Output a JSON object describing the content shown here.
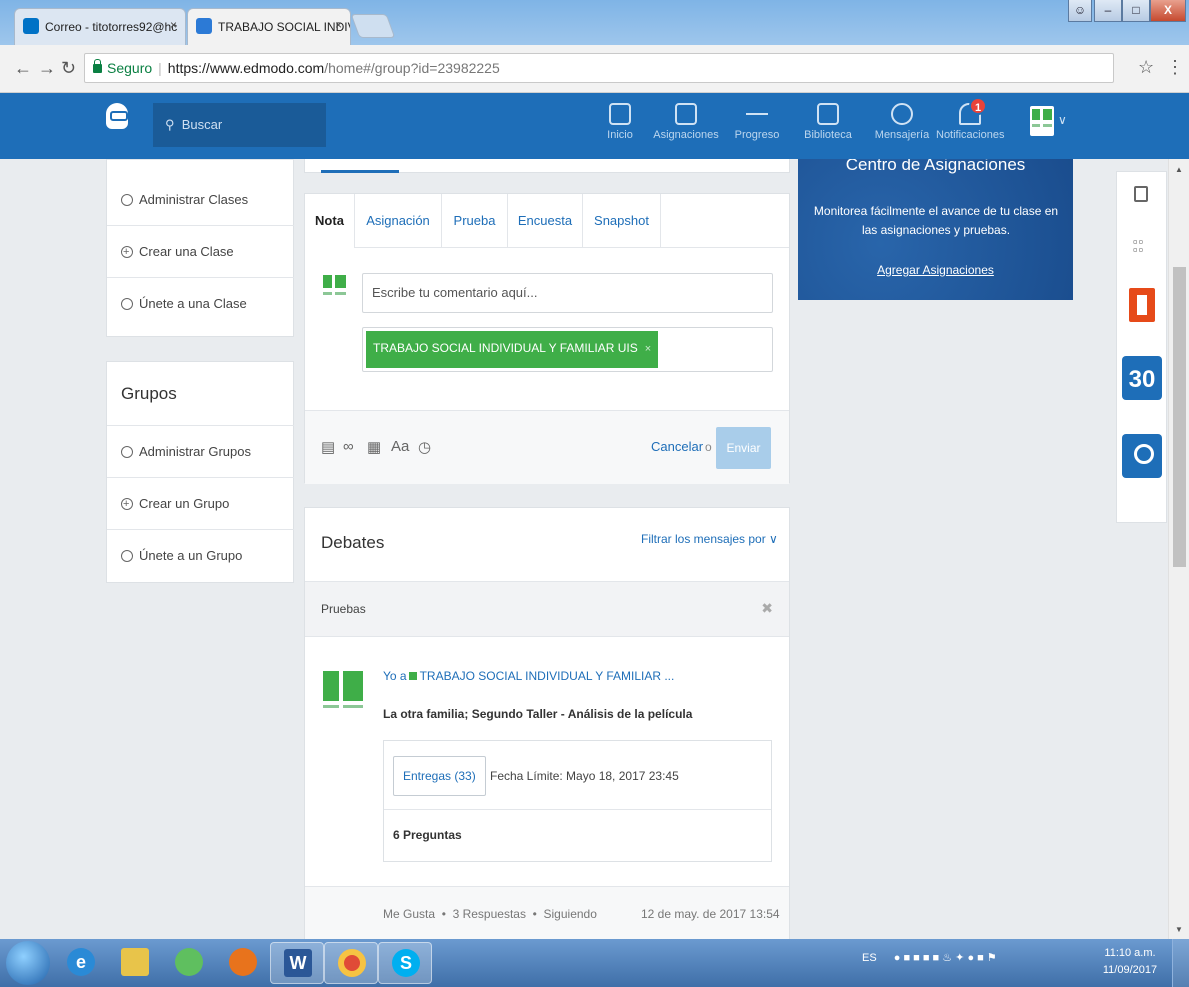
{
  "browser": {
    "tabs": [
      {
        "title": "Correo - titotorres92@hc",
        "close": "×",
        "favicon_color": "#0072c6"
      },
      {
        "title": "TRABAJO SOCIAL INDIVI",
        "close": "×",
        "favicon_color": "#2c7ad6"
      }
    ],
    "secure_label": "Seguro",
    "url_main": "https://www.edmodo.com",
    "url_rest": "/home#/group?id=23982225"
  },
  "header": {
    "search_placeholder": "Buscar",
    "nav": [
      {
        "label": "Inicio"
      },
      {
        "label": "Asignaciones"
      },
      {
        "label": "Progreso"
      },
      {
        "label": "Biblioteca"
      },
      {
        "label": "Mensajería"
      },
      {
        "label": "Notificaciones"
      }
    ],
    "notification_count": "1",
    "accent": "#1e6eb8"
  },
  "sidebar": {
    "classes": [
      {
        "label": "Administrar Clases"
      },
      {
        "label": "Crear una Clase"
      },
      {
        "label": "Únete a una Clase"
      }
    ],
    "groups_title": "Grupos",
    "groups": [
      {
        "label": "Administrar Grupos"
      },
      {
        "label": "Crear un Grupo"
      },
      {
        "label": "Únete a un Grupo"
      }
    ]
  },
  "composer": {
    "tabs": [
      {
        "label": "Nota"
      },
      {
        "label": "Asignación"
      },
      {
        "label": "Prueba"
      },
      {
        "label": "Encuesta"
      },
      {
        "label": "Snapshot"
      }
    ],
    "comment_placeholder": "Escribe tu comentario aquí...",
    "recipient": "TRABAJO SOCIAL INDIVIDUAL Y FAMILIAR UIS",
    "recipient_remove": "×",
    "tools_font_label": "Aa",
    "cancel_label": "Cancelar",
    "or_label": "o",
    "send_label": "Enviar"
  },
  "feed": {
    "title": "Debates",
    "filter_label": "Filtrar los mensajes por ∨",
    "filter_tag": "Pruebas",
    "post": {
      "author": "Yo a",
      "group": "TRABAJO SOCIAL INDIVIDUAL Y FAMILIAR ...",
      "title": "La otra familia; Segundo Taller - Análisis de la película",
      "submissions_label": "Entregas (33)",
      "due_label": "Fecha Límite: Mayo 18, 2017 23:45",
      "questions_label": "6 Preguntas",
      "like_label": "Me Gusta",
      "replies_label": "3 Respuestas",
      "following_label": "Siguiendo",
      "dot": "•",
      "date": "12 de may. de 2017 13:54"
    }
  },
  "promo": {
    "title": "Centro de Asignaciones",
    "text": "Monitorea fácilmente el avance de tu clase en las asignaciones y pruebas.",
    "link": "Agregar Asignaciones"
  },
  "right_panel": {
    "calendar_day": "30"
  },
  "taskbar": {
    "language": "ES",
    "time": "11:10 a.m.",
    "date": "11/09/2017"
  }
}
